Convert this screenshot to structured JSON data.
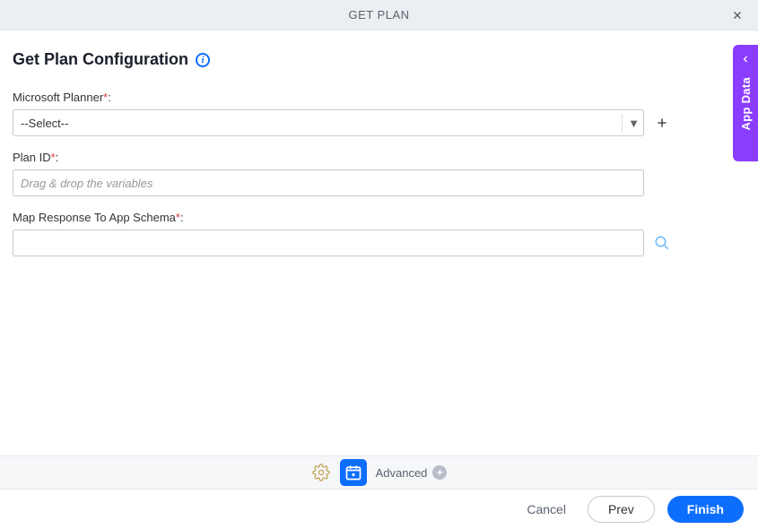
{
  "header": {
    "title": "GET PLAN"
  },
  "page": {
    "title": "Get Plan Configuration"
  },
  "fields": {
    "planner": {
      "label": "Microsoft Planner",
      "required": "*",
      "colon": ":",
      "selected": "--Select--"
    },
    "planId": {
      "label": "Plan ID",
      "required": "*",
      "colon": ":",
      "placeholder": "Drag & drop the variables"
    },
    "schema": {
      "label": "Map Response To App Schema",
      "required": "*",
      "colon": ":"
    }
  },
  "toolbar": {
    "advanced": "Advanced"
  },
  "footer": {
    "cancel": "Cancel",
    "prev": "Prev",
    "finish": "Finish"
  },
  "sideTab": {
    "label": "App Data"
  },
  "colors": {
    "accent": "#0d6efd",
    "side": "#8b3dff"
  }
}
